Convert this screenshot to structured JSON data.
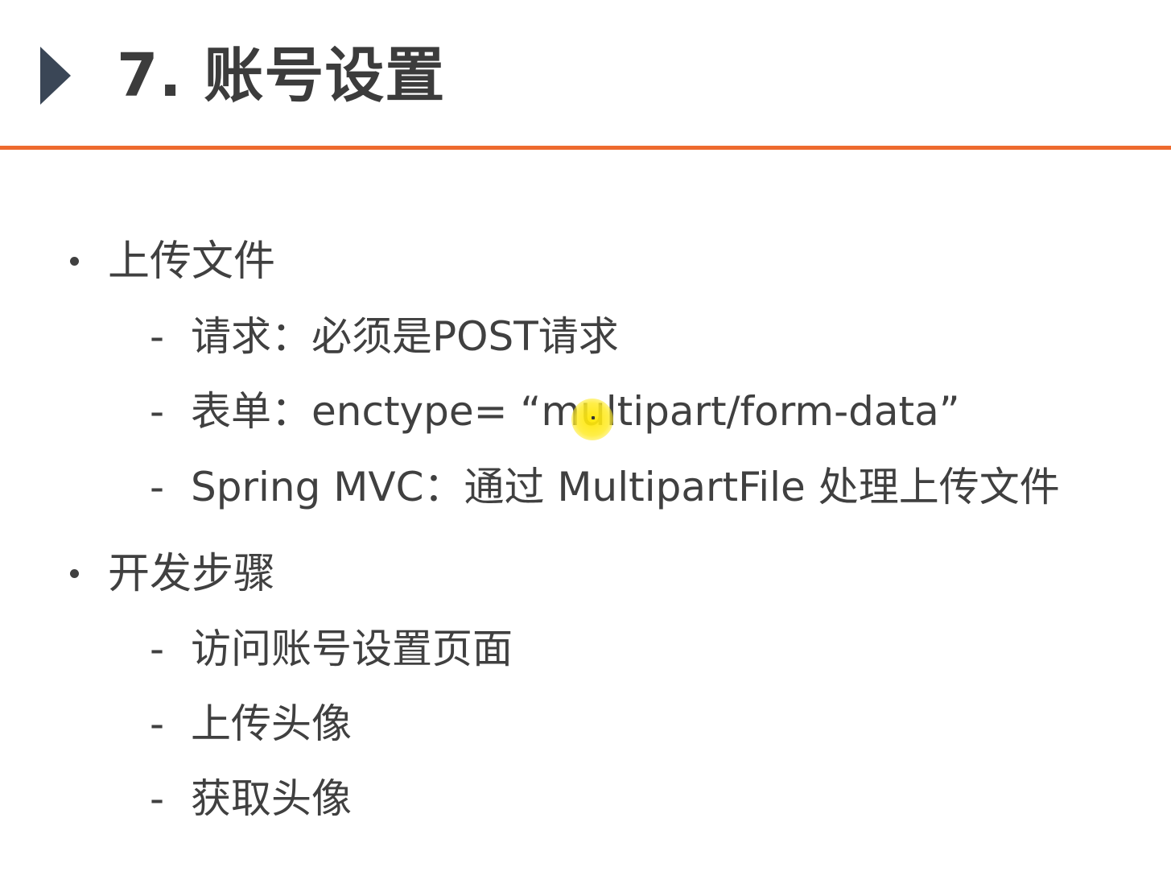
{
  "header": {
    "title": "7. 账号设置"
  },
  "sections": [
    {
      "label": "上传文件",
      "items": [
        "请求：必须是POST请求",
        "表单：enctype= “multipart/form-data”",
        "Spring MVC：通过 MultipartFile 处理上传文件"
      ]
    },
    {
      "label": "开发步骤",
      "items": [
        "访问账号设置页面",
        "上传头像",
        "获取头像"
      ]
    }
  ],
  "colors": {
    "accent_rule": "#ee6a2e",
    "title_arrow": "#3a4656",
    "cursor_highlight": "#ffe600"
  },
  "icons": {
    "title_marker": "triangle-right-icon",
    "pointer": "cursor-highlight-icon"
  }
}
